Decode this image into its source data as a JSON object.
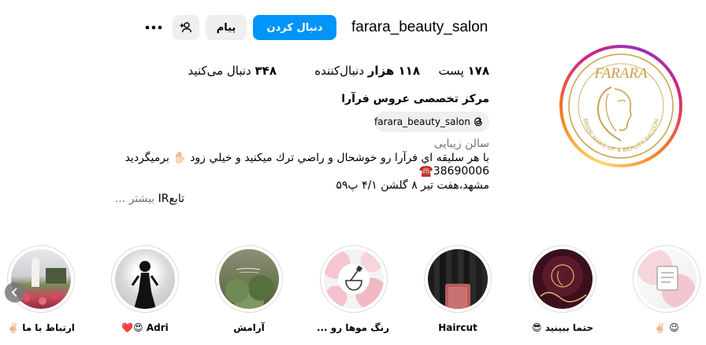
{
  "profile": {
    "username": "farara_beauty_salon",
    "logo_text": "FARARA",
    "logo_subtext": "BRIDE MAKE UP & BEAUTY SALOON"
  },
  "actions": {
    "follow_label": "دنبال کردن",
    "message_label": "پیام"
  },
  "stats": {
    "posts": {
      "value": "۱۷۸",
      "label": "پست"
    },
    "followers": {
      "value": "۱۱۸ هزار",
      "label": "دنبال‌کننده"
    },
    "following": {
      "value": "۳۴۸",
      "label": "دنبال می‌کنید"
    }
  },
  "bio": {
    "full_name": "مرکز تخصصی عروس فرآرا",
    "threads_handle": "farara_beauty_salon",
    "category": "سالن زیبایی",
    "line1": "با هر سليقه اي فرآرا رو خوشحال و راضي ترك ميكنيد و خيلي زود ✋🏻 برميگرديد",
    "line2": "☎️38690006",
    "line3": "مشهد،هفت تیر ۸ گلشن ۴/۱ پ۵۹",
    "more_prefix": "تابع",
    "more_tag": "IR",
    "more_label": "... بیشتر"
  },
  "highlights": [
    {
      "label": "😉 ✌🏻"
    },
    {
      "label": "حتما ببینید 😎"
    },
    {
      "label": "Haircut"
    },
    {
      "label": "رنگ موها رو ..."
    },
    {
      "label": "آرامش"
    },
    {
      "label": "Adri 😍❤️"
    },
    {
      "label": "ارتباط با ما ✌🏻"
    }
  ],
  "colors": {
    "accent": "#0095f6",
    "button_bg": "#efefef",
    "muted_text": "#737373",
    "logo_gold": "#c9a24b"
  },
  "icons": {
    "more": "more-horizontal-icon",
    "add_user": "add-user-icon",
    "threads": "threads-icon",
    "scroll_left": "chevron-left-icon"
  }
}
